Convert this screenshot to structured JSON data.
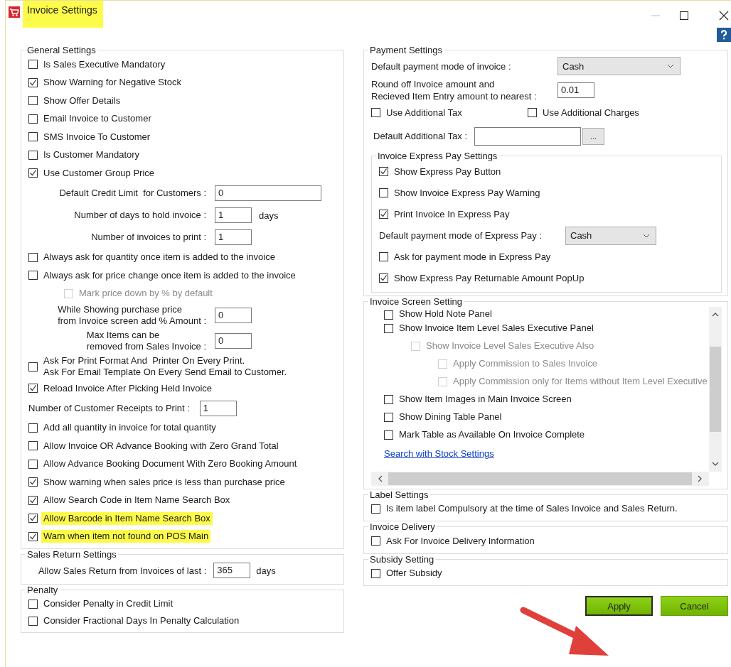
{
  "window": {
    "title": "Invoice Settings",
    "title_highlighted": true
  },
  "general": {
    "title": "General Settings",
    "items": [
      {
        "kind": "checkbox",
        "label": "Is Sales Executive Mandatory",
        "checked": false,
        "disabled": false,
        "highlighted": false
      },
      {
        "kind": "checkbox",
        "label": "Show Warning for Negative Stock",
        "checked": true,
        "disabled": false,
        "highlighted": false
      },
      {
        "kind": "checkbox",
        "label": "Show Offer Details",
        "checked": false,
        "disabled": false,
        "highlighted": false
      },
      {
        "kind": "checkbox",
        "label": "Email Invoice to Customer",
        "checked": false,
        "disabled": false,
        "highlighted": false
      },
      {
        "kind": "checkbox",
        "label": "SMS Invoice To Customer",
        "checked": false,
        "disabled": false,
        "highlighted": false
      },
      {
        "kind": "checkbox",
        "label": "Is Customer Mandatory",
        "checked": false,
        "disabled": false,
        "highlighted": false
      },
      {
        "kind": "checkbox",
        "label": "Use Customer Group Price",
        "checked": true,
        "disabled": false,
        "highlighted": false
      },
      {
        "kind": "field-wide",
        "label": "Default Credit Limit  for Customers :",
        "value": "0"
      },
      {
        "kind": "field",
        "label": "Number of days to hold invoice :",
        "value": "1",
        "suffix": "days"
      },
      {
        "kind": "field",
        "label": "Number of invoices to print :",
        "value": "1"
      },
      {
        "kind": "checkbox",
        "label": "Always ask for quantity once item is added to the invoice",
        "checked": false,
        "disabled": false,
        "highlighted": false
      },
      {
        "kind": "checkbox",
        "label": "Always ask for price change once item is added to the invoice",
        "checked": false,
        "disabled": false,
        "highlighted": false,
        "children": [
          {
            "kind": "checkbox",
            "label": "Mark price down by % by default",
            "checked": false,
            "disabled": true,
            "highlighted": false
          }
        ]
      },
      {
        "kind": "field",
        "label": "While Showing purchase price\nfrom Invoice screen add % Amount :",
        "value": "0"
      },
      {
        "kind": "field",
        "label": "Max Items can be\nremoved from Sales Invoice :",
        "value": "0"
      },
      {
        "kind": "checkbox",
        "label": "Ask For Print Format And  Printer On Every Print.\nAsk For Email Template On Every Send Email to Customer.",
        "checked": false,
        "disabled": false,
        "highlighted": false
      },
      {
        "kind": "checkbox",
        "label": "Reload Invoice After Picking Held Invoice",
        "checked": true,
        "disabled": false,
        "highlighted": false
      },
      {
        "kind": "field-inline",
        "label": "Number of Customer Receipts to Print :",
        "value": "1"
      },
      {
        "kind": "checkbox",
        "label": "Add all quantity in invoice for total quantity",
        "checked": false,
        "disabled": false,
        "highlighted": false
      },
      {
        "kind": "checkbox",
        "label": "Allow Invoice OR Advance Booking with Zero Grand Total",
        "checked": false,
        "disabled": false,
        "highlighted": false
      },
      {
        "kind": "checkbox",
        "label": "Allow Advance Booking Document With Zero Booking Amount",
        "checked": false,
        "disabled": false,
        "highlighted": false
      },
      {
        "kind": "checkbox",
        "label": "Show warning when sales price is less than purchase price",
        "checked": true,
        "disabled": false,
        "highlighted": false
      },
      {
        "kind": "checkbox",
        "label": "Allow Search Code in Item Name Search Box",
        "checked": true,
        "disabled": false,
        "highlighted": false
      },
      {
        "kind": "checkbox",
        "label": "Allow Barcode in Item Name Search Box",
        "checked": true,
        "disabled": false,
        "highlighted": true
      },
      {
        "kind": "checkbox",
        "label": "Warn when item not found on POS Main",
        "checked": true,
        "disabled": false,
        "highlighted": true
      }
    ]
  },
  "sales_return": {
    "title": "Sales Return Settings",
    "label": "Allow Sales Return from Invoices of last :",
    "value": "365",
    "suffix": "days"
  },
  "penalty": {
    "title": "Penalty",
    "items": [
      {
        "label": "Consider Penalty in Credit Limit",
        "checked": false
      },
      {
        "label": "Consider Fractional Days In Penalty Calculation",
        "checked": false
      }
    ]
  },
  "payment": {
    "title": "Payment Settings",
    "mode_label": "Default payment mode of invoice :",
    "mode_value": "Cash",
    "round_label": "Round off Invoice amount and\nRecieved Item Entry amount to nearest :",
    "round_value": "0.01",
    "options": [
      {
        "label": "Use Additional Tax",
        "checked": false
      },
      {
        "label": "Use Additional Charges",
        "checked": false
      }
    ],
    "tax_label": "Default Additional Tax :",
    "tax_button": "...",
    "express": {
      "title": "Invoice Express Pay Settings",
      "items": [
        {
          "kind": "checkbox",
          "label": "Show Express Pay Button",
          "checked": true
        },
        {
          "kind": "checkbox",
          "label": "Show Invoice Express Pay Warning",
          "checked": false
        },
        {
          "kind": "checkbox",
          "label": "Print Invoice In Express Pay",
          "checked": true
        },
        {
          "kind": "select",
          "label": "Default payment mode of Express Pay :",
          "value": "Cash"
        },
        {
          "kind": "checkbox",
          "label": "Ask for payment mode in Express Pay",
          "checked": false
        },
        {
          "kind": "checkbox",
          "label": "Show Express Pay Returnable Amount PopUp",
          "checked": true
        }
      ]
    }
  },
  "screen": {
    "title": "Invoice Screen Setting",
    "items": [
      {
        "label": "Show Hold Note Panel",
        "checked": false,
        "disabled": false
      },
      {
        "label": "Show Invoice Item Level Sales Executive Panel",
        "checked": false,
        "disabled": false,
        "children": [
          {
            "label": "Show Invoice Level Sales Executive Also",
            "checked": false,
            "disabled": true,
            "children": [
              {
                "label": "Apply Commission to Sales Invoice",
                "checked": false,
                "disabled": true
              },
              {
                "label": "Apply Commission only for Items without Item Level Executive",
                "checked": false,
                "disabled": true
              }
            ]
          }
        ]
      },
      {
        "label": "Show Item Images in Main Invoice Screen",
        "checked": false,
        "disabled": false
      },
      {
        "label": "Show Dining Table Panel",
        "checked": false,
        "disabled": false
      },
      {
        "label": "Mark Table as Available On Invoice Complete",
        "checked": false,
        "disabled": false
      }
    ],
    "link": "Search with Stock Settings"
  },
  "label_settings": {
    "title": "Label Settings",
    "items": [
      {
        "label": "Is item label Compulsory at the time of Sales Invoice and Sales Return.",
        "checked": false
      }
    ]
  },
  "delivery": {
    "title": "Invoice Delivery",
    "items": [
      {
        "label": "Ask For Invoice Delivery Information",
        "checked": false
      }
    ]
  },
  "subsidy": {
    "title": "Subsidy Setting",
    "items": [
      {
        "label": "Offer Subsidy",
        "checked": false
      }
    ]
  },
  "buttons": [
    "Apply",
    "Cancel"
  ]
}
